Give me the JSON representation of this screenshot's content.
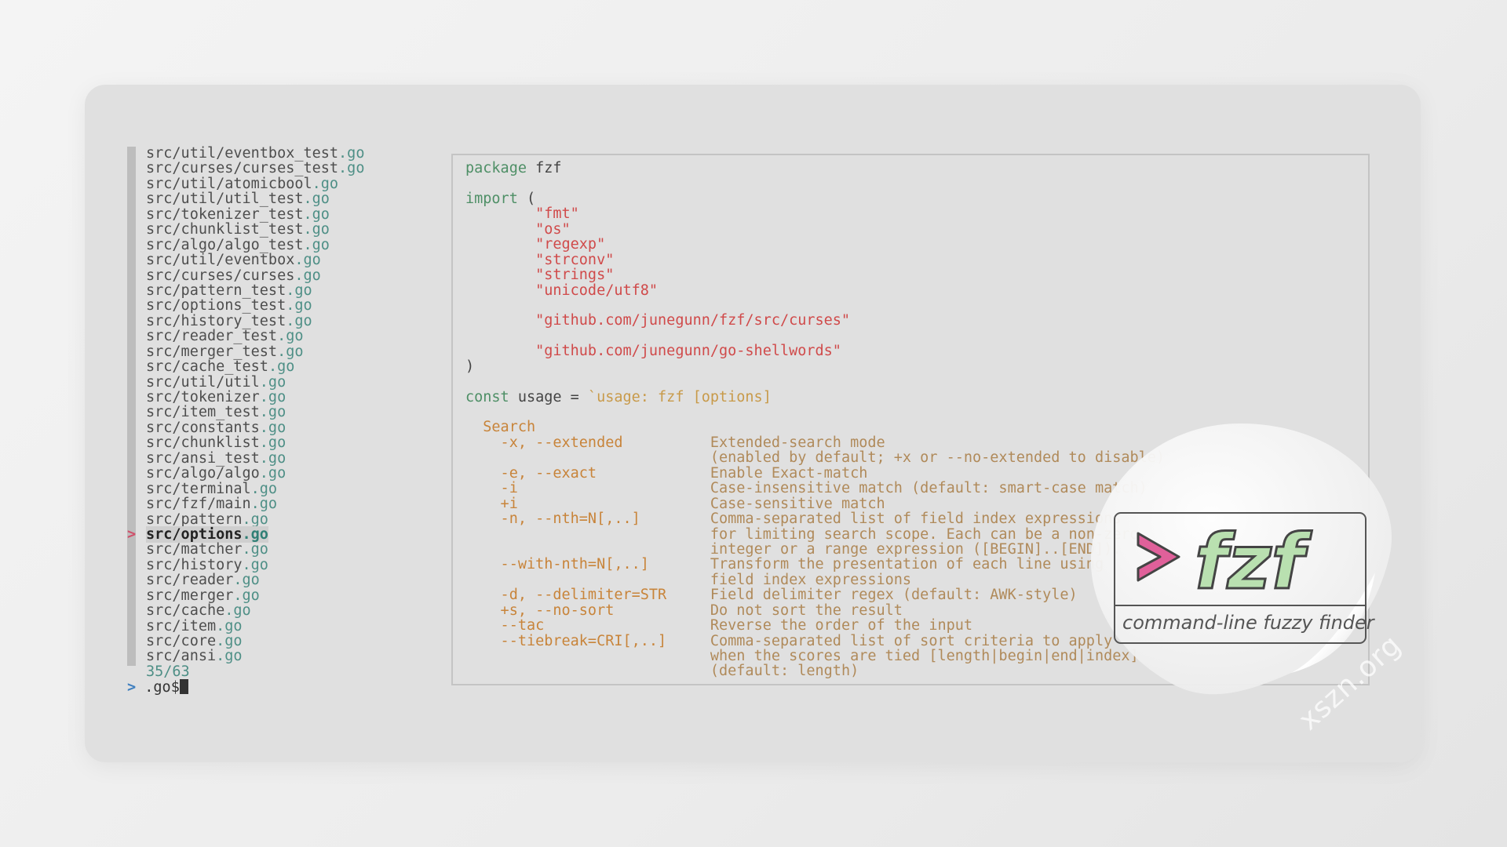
{
  "file_list": {
    "items": [
      {
        "path": "src/util/eventbox_test",
        "ext": ".go"
      },
      {
        "path": "src/curses/curses_test",
        "ext": ".go"
      },
      {
        "path": "src/util/atomicbool",
        "ext": ".go"
      },
      {
        "path": "src/util/util_test",
        "ext": ".go"
      },
      {
        "path": "src/tokenizer_test",
        "ext": ".go"
      },
      {
        "path": "src/chunklist_test",
        "ext": ".go"
      },
      {
        "path": "src/algo/algo_test",
        "ext": ".go"
      },
      {
        "path": "src/util/eventbox",
        "ext": ".go"
      },
      {
        "path": "src/curses/curses",
        "ext": ".go"
      },
      {
        "path": "src/pattern_test",
        "ext": ".go"
      },
      {
        "path": "src/options_test",
        "ext": ".go"
      },
      {
        "path": "src/history_test",
        "ext": ".go"
      },
      {
        "path": "src/reader_test",
        "ext": ".go"
      },
      {
        "path": "src/merger_test",
        "ext": ".go"
      },
      {
        "path": "src/cache_test",
        "ext": ".go"
      },
      {
        "path": "src/util/util",
        "ext": ".go"
      },
      {
        "path": "src/tokenizer",
        "ext": ".go"
      },
      {
        "path": "src/item_test",
        "ext": ".go"
      },
      {
        "path": "src/constants",
        "ext": ".go"
      },
      {
        "path": "src/chunklist",
        "ext": ".go"
      },
      {
        "path": "src/ansi_test",
        "ext": ".go"
      },
      {
        "path": "src/algo/algo",
        "ext": ".go"
      },
      {
        "path": "src/terminal",
        "ext": ".go"
      },
      {
        "path": "src/fzf/main",
        "ext": ".go"
      },
      {
        "path": "src/pattern",
        "ext": ".go"
      },
      {
        "path": "src/options",
        "ext": ".go"
      },
      {
        "path": "src/matcher",
        "ext": ".go"
      },
      {
        "path": "src/history",
        "ext": ".go"
      },
      {
        "path": "src/reader",
        "ext": ".go"
      },
      {
        "path": "src/merger",
        "ext": ".go"
      },
      {
        "path": "src/cache",
        "ext": ".go"
      },
      {
        "path": "src/item",
        "ext": ".go"
      },
      {
        "path": "src/core",
        "ext": ".go"
      },
      {
        "path": "src/ansi",
        "ext": ".go"
      }
    ],
    "selected_index": 25,
    "selection_marker": ">",
    "match_count": "35/63"
  },
  "prompt": {
    "marker": ">",
    "query": ".go$"
  },
  "preview": {
    "lines": [
      [
        {
          "t": "package ",
          "c": "kw"
        },
        {
          "t": "fzf",
          "c": "id"
        }
      ],
      [],
      [
        {
          "t": "import ",
          "c": "kw"
        },
        {
          "t": "(",
          "c": "id"
        }
      ],
      [
        {
          "t": "        ",
          "c": "id"
        },
        {
          "t": "\"fmt\"",
          "c": "str"
        }
      ],
      [
        {
          "t": "        ",
          "c": "id"
        },
        {
          "t": "\"os\"",
          "c": "str"
        }
      ],
      [
        {
          "t": "        ",
          "c": "id"
        },
        {
          "t": "\"regexp\"",
          "c": "str"
        }
      ],
      [
        {
          "t": "        ",
          "c": "id"
        },
        {
          "t": "\"strconv\"",
          "c": "str"
        }
      ],
      [
        {
          "t": "        ",
          "c": "id"
        },
        {
          "t": "\"strings\"",
          "c": "str"
        }
      ],
      [
        {
          "t": "        ",
          "c": "id"
        },
        {
          "t": "\"unicode/utf8\"",
          "c": "str"
        }
      ],
      [],
      [
        {
          "t": "        ",
          "c": "id"
        },
        {
          "t": "\"github.com/junegunn/fzf/src/curses\"",
          "c": "str"
        }
      ],
      [],
      [
        {
          "t": "        ",
          "c": "id"
        },
        {
          "t": "\"github.com/junegunn/go-shellwords\"",
          "c": "str"
        }
      ],
      [
        {
          "t": ")",
          "c": "id"
        }
      ],
      [],
      [
        {
          "t": "const ",
          "c": "kw"
        },
        {
          "t": "usage = ",
          "c": "id"
        },
        {
          "t": "`usage: fzf [options]",
          "c": "bq"
        }
      ],
      [],
      [
        {
          "t": "  Search",
          "c": "hdr"
        }
      ],
      [
        {
          "t": "    -x, --extended          ",
          "c": "opt"
        },
        {
          "t": "Extended-search mode",
          "c": "desc"
        }
      ],
      [
        {
          "t": "                            ",
          "c": "opt"
        },
        {
          "t": "(enabled by default; +x or --no-extended to disable)",
          "c": "desc"
        }
      ],
      [
        {
          "t": "    -e, --exact             ",
          "c": "opt"
        },
        {
          "t": "Enable Exact-match",
          "c": "desc"
        }
      ],
      [
        {
          "t": "    -i                      ",
          "c": "opt"
        },
        {
          "t": "Case-insensitive match (default: smart-case match)",
          "c": "desc"
        }
      ],
      [
        {
          "t": "    +i                      ",
          "c": "opt"
        },
        {
          "t": "Case-sensitive match",
          "c": "desc"
        }
      ],
      [
        {
          "t": "    -n, --nth=N[,..]        ",
          "c": "opt"
        },
        {
          "t": "Comma-separated list of field index expressions",
          "c": "desc"
        }
      ],
      [
        {
          "t": "                            ",
          "c": "opt"
        },
        {
          "t": "for limiting search scope. Each can be a non-zero",
          "c": "desc"
        }
      ],
      [
        {
          "t": "                            ",
          "c": "opt"
        },
        {
          "t": "integer or a range expression ([BEGIN]..[END]).",
          "c": "desc"
        }
      ],
      [
        {
          "t": "    --with-nth=N[,..]       ",
          "c": "opt"
        },
        {
          "t": "Transform the presentation of each line using",
          "c": "desc"
        }
      ],
      [
        {
          "t": "                            ",
          "c": "opt"
        },
        {
          "t": "field index expressions",
          "c": "desc"
        }
      ],
      [
        {
          "t": "    -d, --delimiter=STR     ",
          "c": "opt"
        },
        {
          "t": "Field delimiter regex (default: AWK-style)",
          "c": "desc"
        }
      ],
      [
        {
          "t": "    +s, --no-sort           ",
          "c": "opt"
        },
        {
          "t": "Do not sort the result",
          "c": "desc"
        }
      ],
      [
        {
          "t": "    --tac                   ",
          "c": "opt"
        },
        {
          "t": "Reverse the order of the input",
          "c": "desc"
        }
      ],
      [
        {
          "t": "    --tiebreak=CRI[,..]     ",
          "c": "opt"
        },
        {
          "t": "Comma-separated list of sort criteria to apply",
          "c": "desc"
        }
      ],
      [
        {
          "t": "                            ",
          "c": "opt"
        },
        {
          "t": "when the scores are tied [length|begin|end|index]",
          "c": "desc"
        }
      ],
      [
        {
          "t": "                            ",
          "c": "opt"
        },
        {
          "t": "(default: length)",
          "c": "desc"
        }
      ]
    ]
  },
  "logo": {
    "name": "fzf",
    "tagline": "command-line fuzzy finder",
    "arrow_color": "#e0609a",
    "letter_color": "#b9e0b0"
  },
  "watermark": "xszn.org",
  "colors": {
    "accent_green": "#4e8f86",
    "string_red": "#d04a4a",
    "option_orange": "#c8843a",
    "marker_pink": "#d0506a"
  }
}
